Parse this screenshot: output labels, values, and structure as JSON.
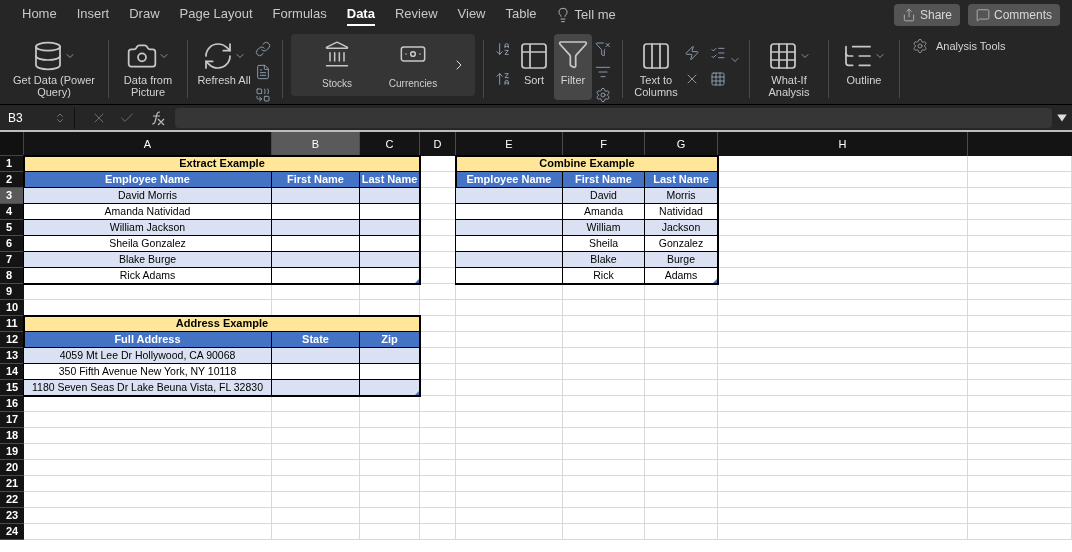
{
  "tabs": [
    {
      "label": "Home",
      "selected": false
    },
    {
      "label": "Insert",
      "selected": false
    },
    {
      "label": "Draw",
      "selected": false
    },
    {
      "label": "Page Layout",
      "selected": false
    },
    {
      "label": "Formulas",
      "selected": false
    },
    {
      "label": "Data",
      "selected": true
    },
    {
      "label": "Review",
      "selected": false
    },
    {
      "label": "View",
      "selected": false
    },
    {
      "label": "Table",
      "selected": false
    }
  ],
  "tell_me": "Tell me",
  "share_button": "Share",
  "comments_button": "Comments",
  "ribbon": {
    "get_data": "Get Data (Power Query)",
    "data_from_picture": "Data from Picture",
    "refresh_all": "Refresh All",
    "gallery": [
      "Stocks",
      "Currencies"
    ],
    "sort": "Sort",
    "filter": {
      "label": "Filter",
      "selected": true
    },
    "text_to_columns": "Text to Columns",
    "what_if": "What-If Analysis",
    "outline": "Outline",
    "analysis_tools": "Analysis Tools"
  },
  "formula_bar": {
    "name_box": "B3"
  },
  "sheet": {
    "columns": [
      {
        "label": "A",
        "selected": false
      },
      {
        "label": "B",
        "selected": true
      },
      {
        "label": "C",
        "selected": false
      },
      {
        "label": "D",
        "selected": false
      },
      {
        "label": "E",
        "selected": false
      },
      {
        "label": "F",
        "selected": false
      },
      {
        "label": "G",
        "selected": false
      },
      {
        "label": "H",
        "selected": false
      }
    ],
    "row_numbers": [
      {
        "label": "1",
        "selected": false
      },
      {
        "label": "2",
        "selected": false
      },
      {
        "label": "3",
        "selected": true
      },
      {
        "label": "4",
        "selected": false
      },
      {
        "label": "5",
        "selected": false
      },
      {
        "label": "6",
        "selected": false
      },
      {
        "label": "7",
        "selected": false
      },
      {
        "label": "8",
        "selected": false
      },
      {
        "label": "9",
        "selected": false
      },
      {
        "label": "10",
        "selected": false
      },
      {
        "label": "11",
        "selected": false
      },
      {
        "label": "12",
        "selected": false
      },
      {
        "label": "13",
        "selected": false
      },
      {
        "label": "14",
        "selected": false
      },
      {
        "label": "15",
        "selected": false
      },
      {
        "label": "16",
        "selected": false
      },
      {
        "label": "17",
        "selected": false
      },
      {
        "label": "18",
        "selected": false
      },
      {
        "label": "19",
        "selected": false
      },
      {
        "label": "20",
        "selected": false
      },
      {
        "label": "21",
        "selected": false
      },
      {
        "label": "22",
        "selected": false
      },
      {
        "label": "23",
        "selected": false
      },
      {
        "label": "24",
        "selected": false
      }
    ],
    "tables": [
      {
        "title": "Extract Example",
        "headers": [
          "Employee Name",
          "First Name",
          "Last Name"
        ],
        "rows": [
          [
            "David Morris",
            null,
            null
          ],
          [
            "Amanda Natividad",
            null,
            null
          ],
          [
            "William Jackson",
            null,
            null
          ],
          [
            "Sheila Gonzalez",
            null,
            null
          ],
          [
            "Blake Burge",
            null,
            null
          ],
          [
            "Rick Adams",
            null,
            null
          ]
        ]
      },
      {
        "title": "Combine Example",
        "headers": [
          "Employee Name",
          "First Name",
          "Last Name"
        ],
        "rows": [
          [
            null,
            "David",
            "Morris"
          ],
          [
            null,
            "Amanda",
            "Natividad"
          ],
          [
            null,
            "William",
            "Jackson"
          ],
          [
            null,
            "Sheila",
            "Gonzalez"
          ],
          [
            null,
            "Blake",
            "Burge"
          ],
          [
            null,
            "Rick",
            "Adams"
          ]
        ]
      },
      {
        "title": "Address Example",
        "headers": [
          "Full Address",
          "State",
          "Zip"
        ],
        "rows": [
          [
            "4059 Mt Lee Dr Hollywood, CA 90068",
            null,
            null
          ],
          [
            "350 Fifth Avenue New York, NY 10118",
            null,
            null
          ],
          [
            "1180 Seven Seas Dr Lake Beuna Vista, FL 32830",
            null,
            null
          ]
        ]
      }
    ]
  }
}
